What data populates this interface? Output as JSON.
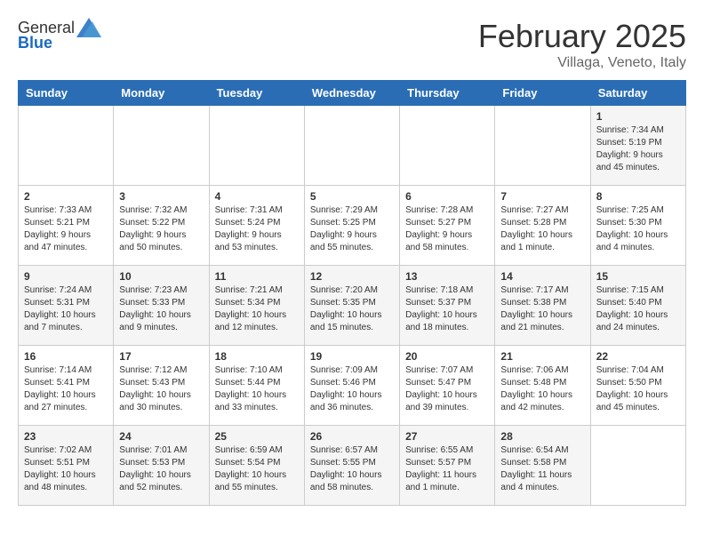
{
  "header": {
    "logo": {
      "general": "General",
      "blue": "Blue"
    },
    "title": "February 2025",
    "location": "Villaga, Veneto, Italy"
  },
  "weekdays": [
    "Sunday",
    "Monday",
    "Tuesday",
    "Wednesday",
    "Thursday",
    "Friday",
    "Saturday"
  ],
  "weeks": [
    [
      {
        "day": "",
        "info": ""
      },
      {
        "day": "",
        "info": ""
      },
      {
        "day": "",
        "info": ""
      },
      {
        "day": "",
        "info": ""
      },
      {
        "day": "",
        "info": ""
      },
      {
        "day": "",
        "info": ""
      },
      {
        "day": "1",
        "info": "Sunrise: 7:34 AM\nSunset: 5:19 PM\nDaylight: 9 hours and 45 minutes."
      }
    ],
    [
      {
        "day": "2",
        "info": "Sunrise: 7:33 AM\nSunset: 5:21 PM\nDaylight: 9 hours and 47 minutes."
      },
      {
        "day": "3",
        "info": "Sunrise: 7:32 AM\nSunset: 5:22 PM\nDaylight: 9 hours and 50 minutes."
      },
      {
        "day": "4",
        "info": "Sunrise: 7:31 AM\nSunset: 5:24 PM\nDaylight: 9 hours and 53 minutes."
      },
      {
        "day": "5",
        "info": "Sunrise: 7:29 AM\nSunset: 5:25 PM\nDaylight: 9 hours and 55 minutes."
      },
      {
        "day": "6",
        "info": "Sunrise: 7:28 AM\nSunset: 5:27 PM\nDaylight: 9 hours and 58 minutes."
      },
      {
        "day": "7",
        "info": "Sunrise: 7:27 AM\nSunset: 5:28 PM\nDaylight: 10 hours and 1 minute."
      },
      {
        "day": "8",
        "info": "Sunrise: 7:25 AM\nSunset: 5:30 PM\nDaylight: 10 hours and 4 minutes."
      }
    ],
    [
      {
        "day": "9",
        "info": "Sunrise: 7:24 AM\nSunset: 5:31 PM\nDaylight: 10 hours and 7 minutes."
      },
      {
        "day": "10",
        "info": "Sunrise: 7:23 AM\nSunset: 5:33 PM\nDaylight: 10 hours and 9 minutes."
      },
      {
        "day": "11",
        "info": "Sunrise: 7:21 AM\nSunset: 5:34 PM\nDaylight: 10 hours and 12 minutes."
      },
      {
        "day": "12",
        "info": "Sunrise: 7:20 AM\nSunset: 5:35 PM\nDaylight: 10 hours and 15 minutes."
      },
      {
        "day": "13",
        "info": "Sunrise: 7:18 AM\nSunset: 5:37 PM\nDaylight: 10 hours and 18 minutes."
      },
      {
        "day": "14",
        "info": "Sunrise: 7:17 AM\nSunset: 5:38 PM\nDaylight: 10 hours and 21 minutes."
      },
      {
        "day": "15",
        "info": "Sunrise: 7:15 AM\nSunset: 5:40 PM\nDaylight: 10 hours and 24 minutes."
      }
    ],
    [
      {
        "day": "16",
        "info": "Sunrise: 7:14 AM\nSunset: 5:41 PM\nDaylight: 10 hours and 27 minutes."
      },
      {
        "day": "17",
        "info": "Sunrise: 7:12 AM\nSunset: 5:43 PM\nDaylight: 10 hours and 30 minutes."
      },
      {
        "day": "18",
        "info": "Sunrise: 7:10 AM\nSunset: 5:44 PM\nDaylight: 10 hours and 33 minutes."
      },
      {
        "day": "19",
        "info": "Sunrise: 7:09 AM\nSunset: 5:46 PM\nDaylight: 10 hours and 36 minutes."
      },
      {
        "day": "20",
        "info": "Sunrise: 7:07 AM\nSunset: 5:47 PM\nDaylight: 10 hours and 39 minutes."
      },
      {
        "day": "21",
        "info": "Sunrise: 7:06 AM\nSunset: 5:48 PM\nDaylight: 10 hours and 42 minutes."
      },
      {
        "day": "22",
        "info": "Sunrise: 7:04 AM\nSunset: 5:50 PM\nDaylight: 10 hours and 45 minutes."
      }
    ],
    [
      {
        "day": "23",
        "info": "Sunrise: 7:02 AM\nSunset: 5:51 PM\nDaylight: 10 hours and 48 minutes."
      },
      {
        "day": "24",
        "info": "Sunrise: 7:01 AM\nSunset: 5:53 PM\nDaylight: 10 hours and 52 minutes."
      },
      {
        "day": "25",
        "info": "Sunrise: 6:59 AM\nSunset: 5:54 PM\nDaylight: 10 hours and 55 minutes."
      },
      {
        "day": "26",
        "info": "Sunrise: 6:57 AM\nSunset: 5:55 PM\nDaylight: 10 hours and 58 minutes."
      },
      {
        "day": "27",
        "info": "Sunrise: 6:55 AM\nSunset: 5:57 PM\nDaylight: 11 hours and 1 minute."
      },
      {
        "day": "28",
        "info": "Sunrise: 6:54 AM\nSunset: 5:58 PM\nDaylight: 11 hours and 4 minutes."
      },
      {
        "day": "",
        "info": ""
      }
    ]
  ]
}
